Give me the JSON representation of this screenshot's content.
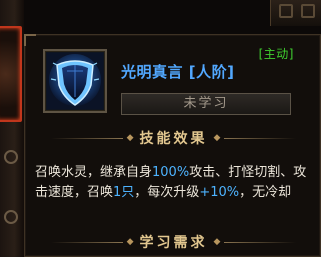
{
  "tooltip": {
    "type_tag": "[主动]",
    "skill_name": "光明真言 [人阶]",
    "status": "未学习",
    "effect_header": "技能效果",
    "description": {
      "p1": "召唤水灵，继承自身",
      "v1": "100%",
      "p2": "攻击、打怪切割、攻击速度，召唤",
      "v2": "1只",
      "p3": "，每次升级",
      "v3": "+10%",
      "p4": "，无冷却"
    },
    "requirement_header": "学习需求"
  },
  "icons": {
    "skill_icon": "glowing-shield-icon",
    "ornament": "diamond-ornament"
  },
  "colors": {
    "skill_name": "#52a8ff",
    "active_tag": "#3fcf2f",
    "highlight": "#4db3ff",
    "header": "#e2c78f",
    "slot_border": "#c0361c"
  }
}
